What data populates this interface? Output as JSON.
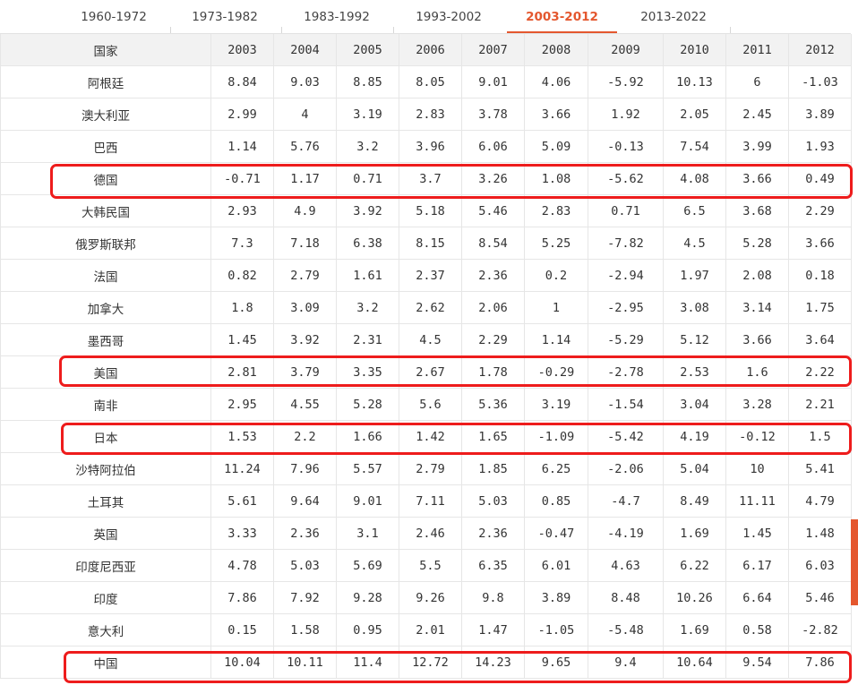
{
  "tabs": [
    {
      "label": "1960-1972",
      "active": false
    },
    {
      "label": "1973-1982",
      "active": false
    },
    {
      "label": "1983-1992",
      "active": false
    },
    {
      "label": "1993-2002",
      "active": false
    },
    {
      "label": "2003-2012",
      "active": true
    },
    {
      "label": "2013-2022",
      "active": false
    }
  ],
  "table": {
    "country_header": "国家",
    "years": [
      "2003",
      "2004",
      "2005",
      "2006",
      "2007",
      "2008",
      "2009",
      "2010",
      "2011",
      "2012"
    ],
    "rows": [
      {
        "country": "阿根廷",
        "values": [
          "8.84",
          "9.03",
          "8.85",
          "8.05",
          "9.01",
          "4.06",
          "-5.92",
          "10.13",
          "6",
          "-1.03"
        ]
      },
      {
        "country": "澳大利亚",
        "values": [
          "2.99",
          "4",
          "3.19",
          "2.83",
          "3.78",
          "3.66",
          "1.92",
          "2.05",
          "2.45",
          "3.89"
        ]
      },
      {
        "country": "巴西",
        "values": [
          "1.14",
          "5.76",
          "3.2",
          "3.96",
          "6.06",
          "5.09",
          "-0.13",
          "7.54",
          "3.99",
          "1.93"
        ]
      },
      {
        "country": "德国",
        "values": [
          "-0.71",
          "1.17",
          "0.71",
          "3.7",
          "3.26",
          "1.08",
          "-5.62",
          "4.08",
          "3.66",
          "0.49"
        ]
      },
      {
        "country": "大韩民国",
        "values": [
          "2.93",
          "4.9",
          "3.92",
          "5.18",
          "5.46",
          "2.83",
          "0.71",
          "6.5",
          "3.68",
          "2.29"
        ]
      },
      {
        "country": "俄罗斯联邦",
        "values": [
          "7.3",
          "7.18",
          "6.38",
          "8.15",
          "8.54",
          "5.25",
          "-7.82",
          "4.5",
          "5.28",
          "3.66"
        ]
      },
      {
        "country": "法国",
        "values": [
          "0.82",
          "2.79",
          "1.61",
          "2.37",
          "2.36",
          "0.2",
          "-2.94",
          "1.97",
          "2.08",
          "0.18"
        ]
      },
      {
        "country": "加拿大",
        "values": [
          "1.8",
          "3.09",
          "3.2",
          "2.62",
          "2.06",
          "1",
          "-2.95",
          "3.08",
          "3.14",
          "1.75"
        ]
      },
      {
        "country": "墨西哥",
        "values": [
          "1.45",
          "3.92",
          "2.31",
          "4.5",
          "2.29",
          "1.14",
          "-5.29",
          "5.12",
          "3.66",
          "3.64"
        ]
      },
      {
        "country": "美国",
        "values": [
          "2.81",
          "3.79",
          "3.35",
          "2.67",
          "1.78",
          "-0.29",
          "-2.78",
          "2.53",
          "1.6",
          "2.22"
        ]
      },
      {
        "country": "南非",
        "values": [
          "2.95",
          "4.55",
          "5.28",
          "5.6",
          "5.36",
          "3.19",
          "-1.54",
          "3.04",
          "3.28",
          "2.21"
        ]
      },
      {
        "country": "日本",
        "values": [
          "1.53",
          "2.2",
          "1.66",
          "1.42",
          "1.65",
          "-1.09",
          "-5.42",
          "4.19",
          "-0.12",
          "1.5"
        ]
      },
      {
        "country": "沙特阿拉伯",
        "values": [
          "11.24",
          "7.96",
          "5.57",
          "2.79",
          "1.85",
          "6.25",
          "-2.06",
          "5.04",
          "10",
          "5.41"
        ]
      },
      {
        "country": "土耳其",
        "values": [
          "5.61",
          "9.64",
          "9.01",
          "7.11",
          "5.03",
          "0.85",
          "-4.7",
          "8.49",
          "11.11",
          "4.79"
        ]
      },
      {
        "country": "英国",
        "values": [
          "3.33",
          "2.36",
          "3.1",
          "2.46",
          "2.36",
          "-0.47",
          "-4.19",
          "1.69",
          "1.45",
          "1.48"
        ]
      },
      {
        "country": "印度尼西亚",
        "values": [
          "4.78",
          "5.03",
          "5.69",
          "5.5",
          "6.35",
          "6.01",
          "4.63",
          "6.22",
          "6.17",
          "6.03"
        ]
      },
      {
        "country": "印度",
        "values": [
          "7.86",
          "7.92",
          "9.28",
          "9.26",
          "9.8",
          "3.89",
          "8.48",
          "10.26",
          "6.64",
          "5.46"
        ]
      },
      {
        "country": "意大利",
        "values": [
          "0.15",
          "1.58",
          "0.95",
          "2.01",
          "1.47",
          "-1.05",
          "-5.48",
          "1.69",
          "0.58",
          "-2.82"
        ]
      },
      {
        "country": "中国",
        "values": [
          "10.04",
          "10.11",
          "11.4",
          "12.72",
          "14.23",
          "9.65",
          "9.4",
          "10.64",
          "9.54",
          "7.86"
        ]
      }
    ]
  },
  "highlight_color": "#ee1c1c",
  "accent_color": "#e4572e"
}
